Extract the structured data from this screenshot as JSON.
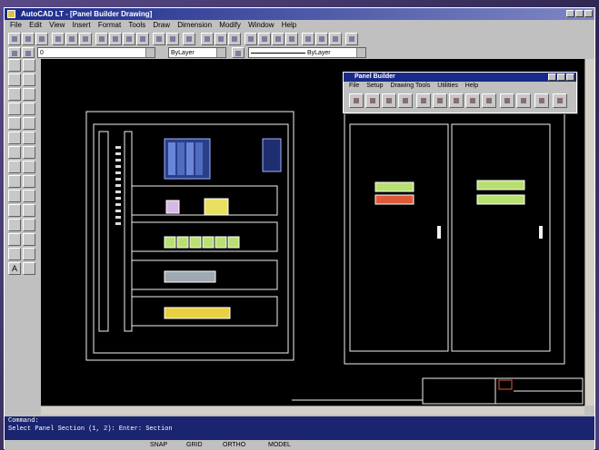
{
  "app": {
    "title": "AutoCAD LT - [Panel Builder Drawing]",
    "menu": [
      "File",
      "Edit",
      "View",
      "Insert",
      "Format",
      "Tools",
      "Draw",
      "Dimension",
      "Modify",
      "Window",
      "Help"
    ]
  },
  "toolbar": {
    "layer_combo": "0",
    "color_combo": "ByLayer",
    "linetype_combo": "ByLayer"
  },
  "left_toolbar": {
    "text_tool_label": "A"
  },
  "dialog": {
    "title": "Panel Builder",
    "menu": [
      "File",
      "Setup",
      "Drawing Tools",
      "Utilities",
      "Help"
    ]
  },
  "command_line": {
    "lines": [
      "Command:",
      "Select Panel Section (1, 2): Enter: Section"
    ]
  },
  "status": {
    "coords": "",
    "modes": [
      "SNAP",
      "GRID",
      "ORTHO",
      "MODEL"
    ]
  },
  "colors": {
    "canvas": "#000000",
    "line": "#f2f2f2",
    "title_bar": "#1a2a8a",
    "accent_yellow": "#e8e060",
    "accent_green": "#b8e070",
    "accent_red": "#e05a3a",
    "plc_blue": "#3355aa"
  }
}
